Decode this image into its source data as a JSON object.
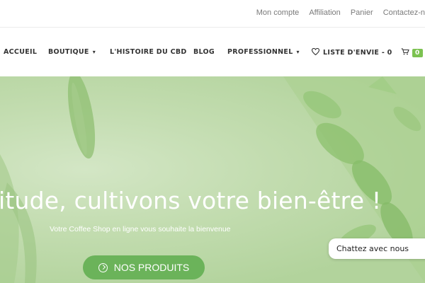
{
  "topbar": {
    "links": [
      "Mon compte",
      "Affiliation",
      "Panier",
      "Contactez-n"
    ]
  },
  "nav": {
    "accueil": "ACCUEIL",
    "boutique": "BOUTIQUE",
    "histoire": "L'HISTOIRE DU CBD",
    "blog": "BLOG",
    "professionnel": "PROFESSIONNEL",
    "wishlist": "LISTE D'ENVIE - 0",
    "cart_count": "0"
  },
  "hero": {
    "title": "itude, cultivons votre bien-être !",
    "subtitle": "Votre Coffee Shop en ligne vous souhaite la bienvenue",
    "cta": "NOS PRODUITS"
  },
  "chat": {
    "label": "Chattez avec nous"
  },
  "icons": [
    "chevron-down-icon",
    "heart-icon",
    "cart-icon",
    "arrow-circle-right-icon"
  ],
  "colors": {
    "accent": "#7cc251",
    "cta": "#6bb35a",
    "hero": "#c2dcaf"
  }
}
